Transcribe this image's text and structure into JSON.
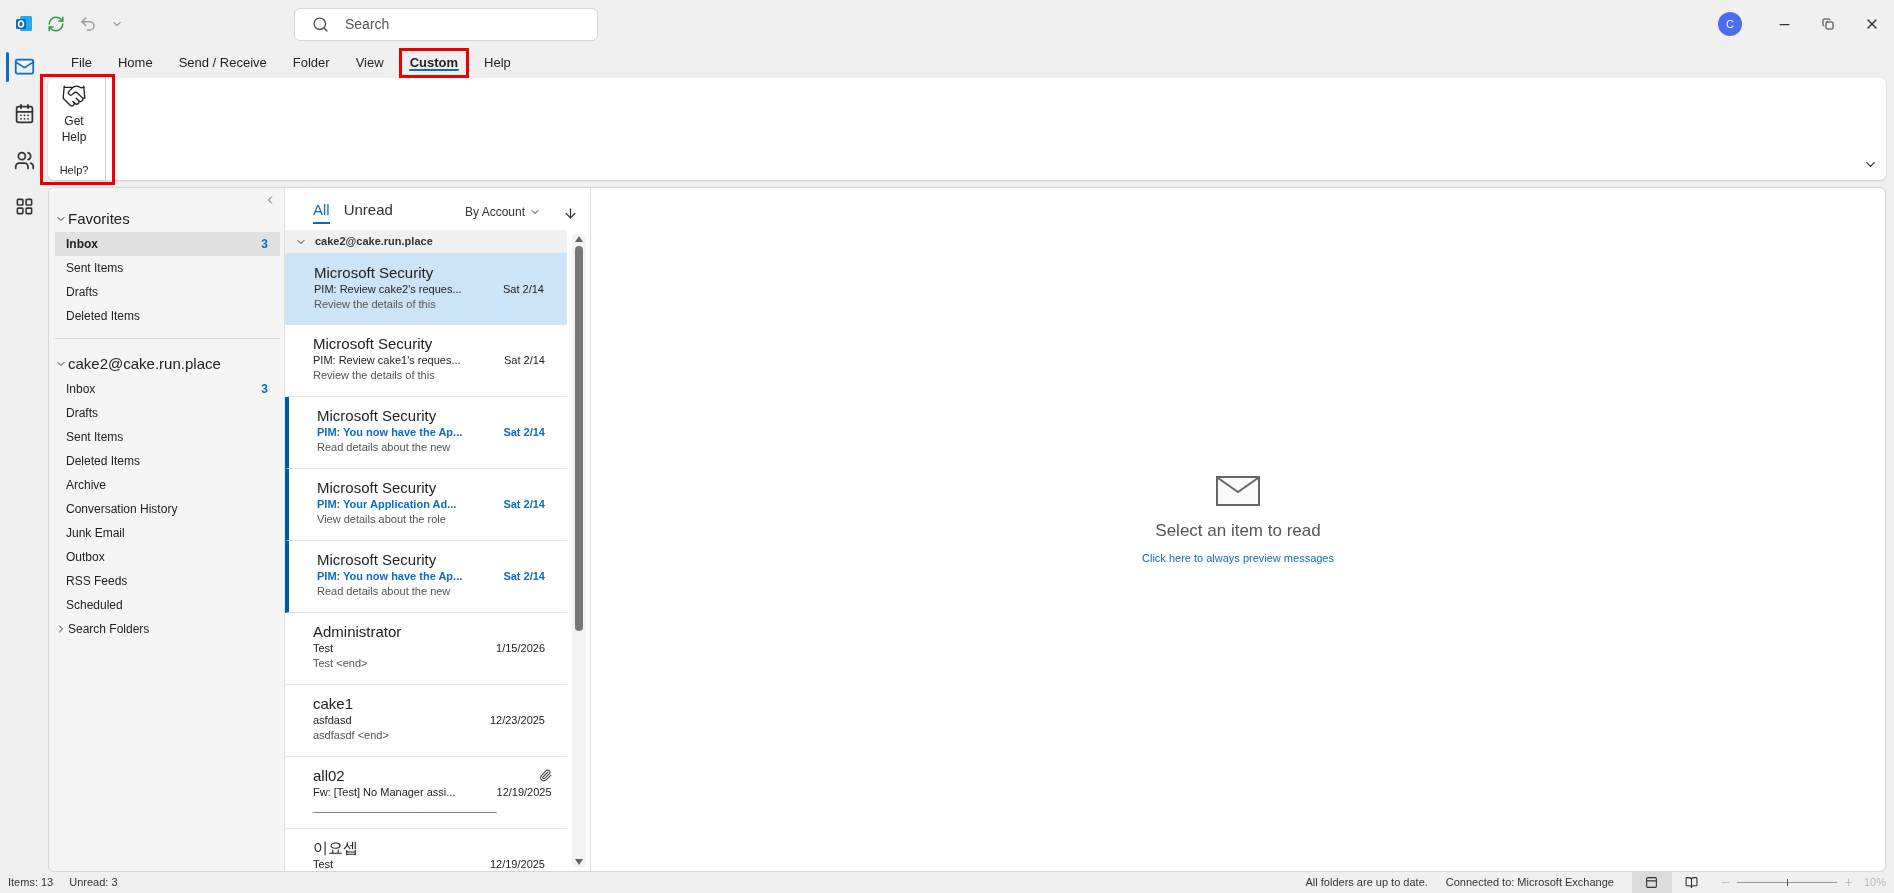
{
  "search": {
    "placeholder": "Search"
  },
  "account_avatar": "C",
  "ribbon_tabs": [
    {
      "label": "File",
      "selected": false,
      "highlighted": false
    },
    {
      "label": "Home",
      "selected": false,
      "highlighted": false
    },
    {
      "label": "Send / Receive",
      "selected": false,
      "highlighted": false
    },
    {
      "label": "Folder",
      "selected": false,
      "highlighted": false
    },
    {
      "label": "View",
      "selected": false,
      "highlighted": false
    },
    {
      "label": "Custom",
      "selected": true,
      "highlighted": true
    },
    {
      "label": "Help",
      "selected": false,
      "highlighted": false
    }
  ],
  "ribbon_groups": [
    {
      "buttons": [
        {
          "label": "Get Help"
        }
      ],
      "label": "Help?",
      "highlighted": true
    }
  ],
  "folder_sections": [
    {
      "title": "Favorites",
      "expanded": true,
      "items": [
        {
          "name": "Inbox",
          "count": "3",
          "selected": true
        },
        {
          "name": "Sent Items",
          "selected": false
        },
        {
          "name": "Drafts",
          "selected": false
        },
        {
          "name": "Deleted Items",
          "selected": false
        }
      ]
    },
    {
      "title": "cake2@cake.run.place",
      "expanded": true,
      "items": [
        {
          "name": "Inbox",
          "count": "3",
          "selected": false
        },
        {
          "name": "Drafts",
          "selected": false
        },
        {
          "name": "Sent Items",
          "selected": false
        },
        {
          "name": "Deleted Items",
          "selected": false
        },
        {
          "name": "Archive",
          "selected": false
        },
        {
          "name": "Conversation History",
          "selected": false
        },
        {
          "name": "Junk Email",
          "selected": false
        },
        {
          "name": "Outbox",
          "selected": false
        },
        {
          "name": "RSS Feeds",
          "selected": false
        },
        {
          "name": "Scheduled",
          "selected": false
        }
      ]
    },
    {
      "title": "Search Folders",
      "expanded": false
    }
  ],
  "message_filters": [
    {
      "label": "All",
      "selected": true
    },
    {
      "label": "Unread",
      "selected": false
    }
  ],
  "sort": {
    "label": "By Account"
  },
  "message_group": {
    "title": "cake2@cake.run.place",
    "expanded": true
  },
  "messages": [
    {
      "sender": "Microsoft Security",
      "subject": "PIM: Review cake2's reques...",
      "preview": "Review the details of this",
      "date": "Sat 2/14",
      "unread": false,
      "selected": true,
      "attachment": false
    },
    {
      "sender": "Microsoft Security",
      "subject": "PIM: Review cake1's reques...",
      "preview": "Review the details of this",
      "date": "Sat 2/14",
      "unread": false,
      "selected": false,
      "attachment": false
    },
    {
      "sender": "Microsoft Security",
      "subject": "PIM: You now have the Ap...",
      "preview": "Read details about the new",
      "date": "Sat 2/14",
      "unread": true,
      "selected": false,
      "attachment": false
    },
    {
      "sender": "Microsoft Security",
      "subject": "PIM: Your Application Ad...",
      "preview": "View details about the role",
      "date": "Sat 2/14",
      "unread": true,
      "selected": false,
      "attachment": false
    },
    {
      "sender": "Microsoft Security",
      "subject": "PIM: You now have the Ap...",
      "preview": "Read details about the new",
      "date": "Sat 2/14",
      "unread": true,
      "selected": false,
      "attachment": false
    },
    {
      "sender": "Administrator",
      "subject": "Test",
      "preview": "Test <end>",
      "date": "1/15/2026",
      "unread": false,
      "selected": false,
      "attachment": false
    },
    {
      "sender": "cake1",
      "subject": "asfdasd",
      "preview": "asdfasdf <end>",
      "date": "12/23/2025",
      "unread": false,
      "selected": false,
      "attachment": false
    },
    {
      "sender": "all02",
      "subject": "Fw: [Test] No Manager assi...",
      "preview": "______________________________",
      "date": "12/19/2025",
      "unread": false,
      "selected": false,
      "attachment": true
    },
    {
      "sender": "이요셉",
      "subject": "Test",
      "date": "12/19/2025",
      "unread": false,
      "selected": false,
      "attachment": false
    }
  ],
  "reading_pane": {
    "message": "Select an item to read",
    "link": "Click here to always preview messages"
  },
  "status_bar": {
    "items": "Items: 13",
    "unread": "Unread: 3",
    "sync": "All folders are up to date.",
    "connection": "Connected to: Microsoft Exchange",
    "zoom": {
      "level": 0.5,
      "label": "10%"
    }
  }
}
